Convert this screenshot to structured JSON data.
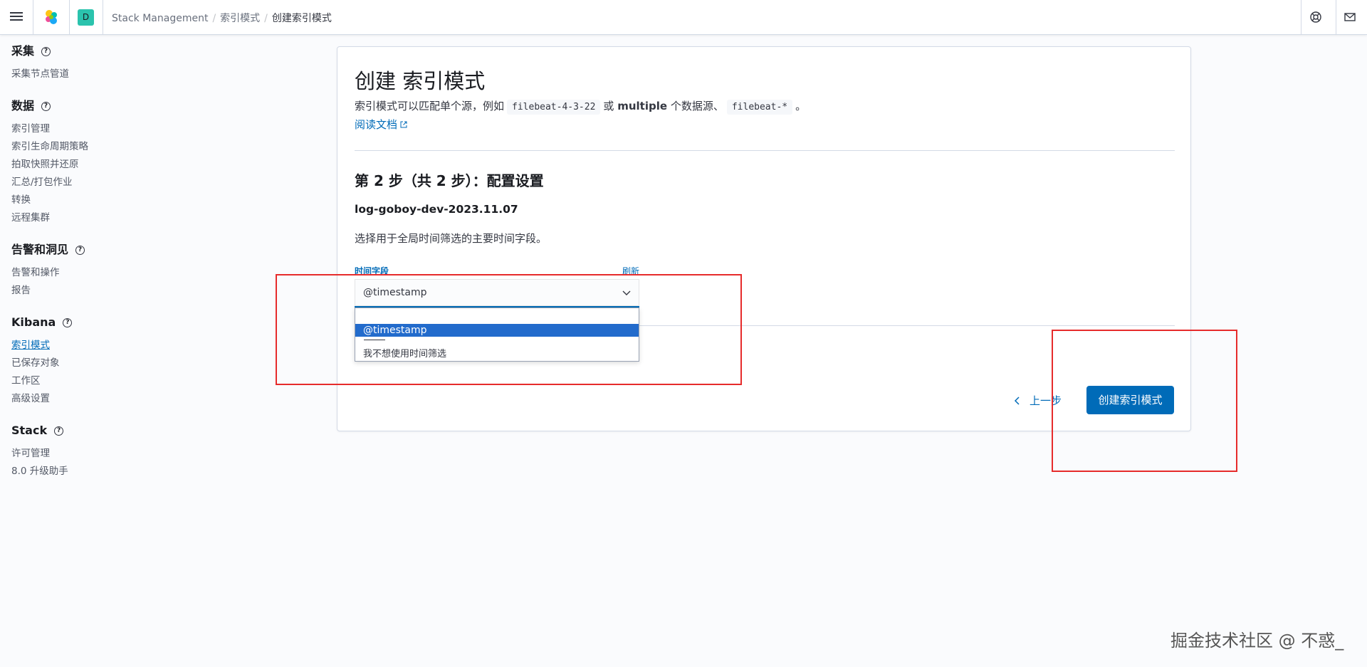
{
  "header": {
    "space_initial": "D",
    "breadcrumbs": [
      "Stack Management",
      "索引模式",
      "创建索引模式"
    ]
  },
  "sidebar": {
    "groups": [
      {
        "title": "采集",
        "items": [
          "采集节点管道"
        ]
      },
      {
        "title": "数据",
        "items": [
          "索引管理",
          "索引生命周期策略",
          "拍取快照并还原",
          "汇总/打包作业",
          "转换",
          "远程集群"
        ]
      },
      {
        "title": "告警和洞见",
        "items": [
          "告警和操作",
          "报告"
        ]
      },
      {
        "title": "Kibana",
        "items": [
          "索引模式",
          "已保存对象",
          "工作区",
          "高级设置"
        ]
      },
      {
        "title": "Stack",
        "items": [
          "许可管理",
          "8.0 升级助手"
        ]
      }
    ],
    "active_item": "索引模式"
  },
  "panel": {
    "title": "创建 索引模式",
    "desc_prefix": "索引模式可以匹配单个源，例如",
    "desc_code1": "filebeat-4-3-22",
    "desc_or": "或",
    "desc_bold": "multiple",
    "desc_mid": "个数据源、",
    "desc_code2": "filebeat-*",
    "desc_end": "。",
    "doc_link": "阅读文档",
    "step_title": "第 2 步（共 2 步）：配置设置",
    "index_name": "log-goboy-dev-2023.11.07",
    "hint": "选择用于全局时间筛选的主要时间字段。",
    "field_label": "时间字段",
    "refresh_label": "刷新",
    "select_value": "@timestamp",
    "options": [
      "@timestamp",
      "我不想使用时间筛选"
    ],
    "back_label": "上一步",
    "create_label": "创建索引模式"
  },
  "watermark": "掘金技术社区 @ 不惑_",
  "colors": {
    "primary": "#006bb8",
    "highlight": "#226bcc",
    "annotation_red": "#e62b2b",
    "space_badge": "#2bc3ad"
  }
}
